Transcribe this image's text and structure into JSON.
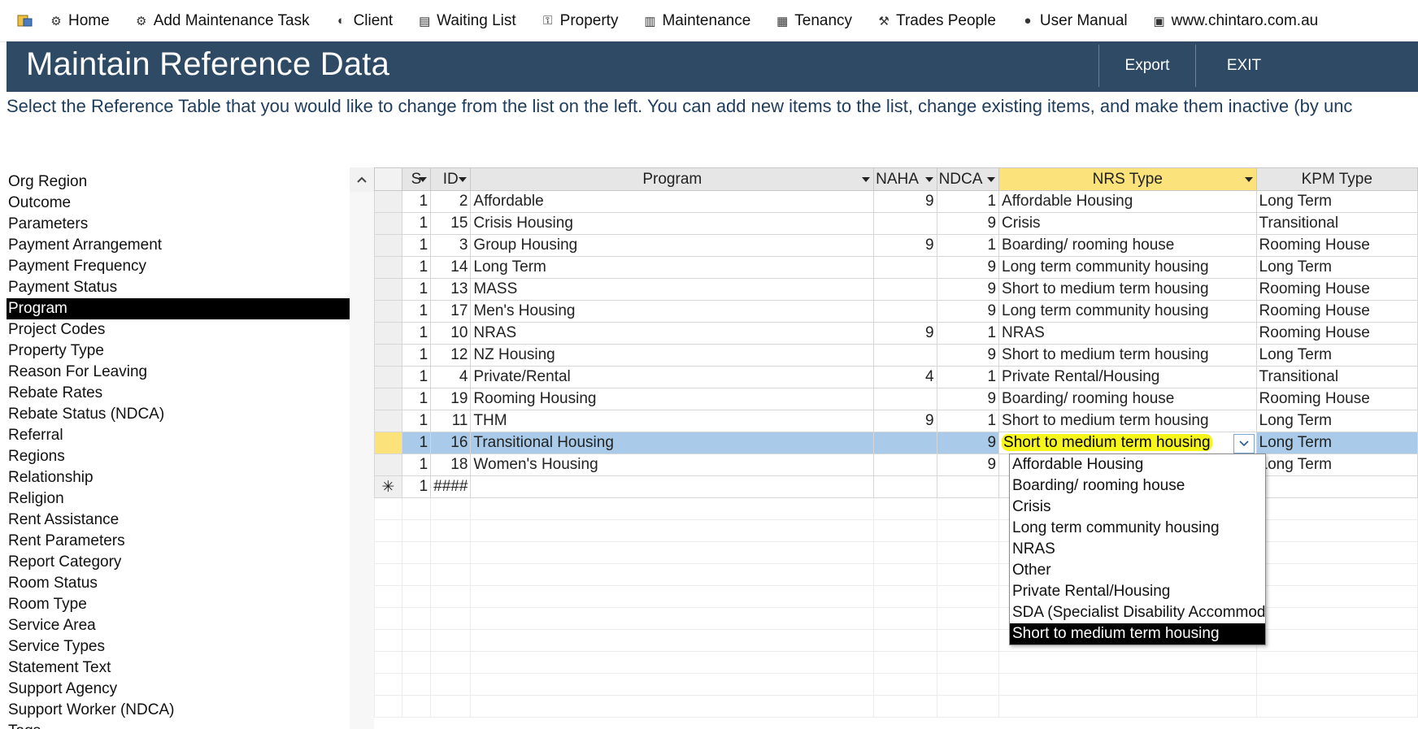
{
  "menu": [
    {
      "icon": "home-icon",
      "glyph": "⚙",
      "label": "Home"
    },
    {
      "icon": "wrench-icon",
      "glyph": "⚙",
      "label": "Add Maintenance Task"
    },
    {
      "icon": "client-icon",
      "glyph": "◐",
      "label": "Client"
    },
    {
      "icon": "list-icon",
      "glyph": "▤",
      "label": "Waiting List"
    },
    {
      "icon": "key-icon",
      "glyph": "⚿",
      "label": "Property"
    },
    {
      "icon": "trash-icon",
      "glyph": "▥",
      "label": "Maintenance"
    },
    {
      "icon": "building-icon",
      "glyph": "▦",
      "label": "Tenancy"
    },
    {
      "icon": "tools-icon",
      "glyph": "⚒",
      "label": "Trades People"
    },
    {
      "icon": "help-icon",
      "glyph": "●",
      "label": "User Manual"
    },
    {
      "icon": "web-icon",
      "glyph": "▣",
      "label": "www.chintaro.com.au"
    }
  ],
  "header": {
    "title": "Maintain Reference Data",
    "export_label": "Export",
    "exit_label": "EXIT"
  },
  "instructions": "Select the Reference Table that you would like to change from the list on the left. You can add new items to the list, change existing items, and make them inactive (by unc",
  "reference_tables": {
    "items": [
      "Org Region",
      "Outcome",
      "Parameters",
      "Payment Arrangement",
      "Payment Frequency",
      "Payment Status",
      "Program",
      "Project Codes",
      "Property Type",
      "Reason For Leaving",
      "Rebate Rates",
      "Rebate Status (NDCA)",
      "Referral",
      "Regions",
      "Relationship",
      "Religion",
      "Rent Assistance",
      "Rent Parameters",
      "Report Category",
      "Room Status",
      "Room Type",
      "Service Area",
      "Service Types",
      "Statement Text",
      "Support Agency",
      "Support Worker (NDCA)",
      "Tags"
    ],
    "selected": "Program"
  },
  "grid": {
    "columns": [
      "S",
      "ID",
      "Program",
      "NAHA",
      "NDCA",
      "NRS Type",
      "KPM Type"
    ],
    "rows": [
      {
        "s": "1",
        "id": "2",
        "program": "Affordable",
        "naha": "9",
        "ndca": "1",
        "nrs": "Affordable Housing",
        "kpm": "Long Term"
      },
      {
        "s": "1",
        "id": "15",
        "program": "Crisis Housing",
        "naha": "",
        "ndca": "9",
        "nrs": "Crisis",
        "kpm": "Transitional"
      },
      {
        "s": "1",
        "id": "3",
        "program": "Group Housing",
        "naha": "9",
        "ndca": "1",
        "nrs": "Boarding/ rooming house",
        "kpm": "Rooming House"
      },
      {
        "s": "1",
        "id": "14",
        "program": "Long Term",
        "naha": "",
        "ndca": "9",
        "nrs": "Long term community housing",
        "kpm": "Long Term"
      },
      {
        "s": "1",
        "id": "13",
        "program": "MASS",
        "naha": "",
        "ndca": "9",
        "nrs": "Short to medium term housing",
        "kpm": "Rooming House"
      },
      {
        "s": "1",
        "id": "17",
        "program": "Men's Housing",
        "naha": "",
        "ndca": "9",
        "nrs": "Long term community housing",
        "kpm": "Rooming House"
      },
      {
        "s": "1",
        "id": "10",
        "program": "NRAS",
        "naha": "9",
        "ndca": "1",
        "nrs": "NRAS",
        "kpm": "Rooming House"
      },
      {
        "s": "1",
        "id": "12",
        "program": "NZ Housing",
        "naha": "",
        "ndca": "9",
        "nrs": "Short to medium term housing",
        "kpm": "Long Term"
      },
      {
        "s": "1",
        "id": "4",
        "program": "Private/Rental",
        "naha": "4",
        "ndca": "1",
        "nrs": "Private Rental/Housing",
        "kpm": "Transitional"
      },
      {
        "s": "1",
        "id": "19",
        "program": "Rooming Housing",
        "naha": "",
        "ndca": "9",
        "nrs": "Boarding/ rooming house",
        "kpm": "Rooming House"
      },
      {
        "s": "1",
        "id": "11",
        "program": "THM",
        "naha": "9",
        "ndca": "1",
        "nrs": "Short to medium term housing",
        "kpm": "Long Term"
      },
      {
        "s": "1",
        "id": "16",
        "program": "Transitional Housing",
        "naha": "",
        "ndca": "9",
        "nrs": "Short to medium term housing",
        "kpm": "Long Term"
      },
      {
        "s": "1",
        "id": "18",
        "program": "Women's Housing",
        "naha": "",
        "ndca": "9",
        "nrs": "",
        "kpm": "Long Term"
      }
    ],
    "active_row_index": 11,
    "new_row": {
      "marker": "✳",
      "s": "1",
      "id": "####"
    }
  },
  "nrs_dropdown": {
    "options": [
      "Affordable Housing",
      "Boarding/ rooming house",
      "Crisis",
      "Long term community housing",
      "NRAS",
      "Other",
      "Private Rental/Housing",
      "SDA (Specialist Disability Accommodation)",
      "Short to medium term housing"
    ],
    "selected": "Short to medium term housing"
  },
  "colors": {
    "header_bg": "#2e4a65",
    "active_row": "#a9cbe9",
    "nrs_header": "#fbe27a",
    "highlight": "#f6f61a"
  }
}
